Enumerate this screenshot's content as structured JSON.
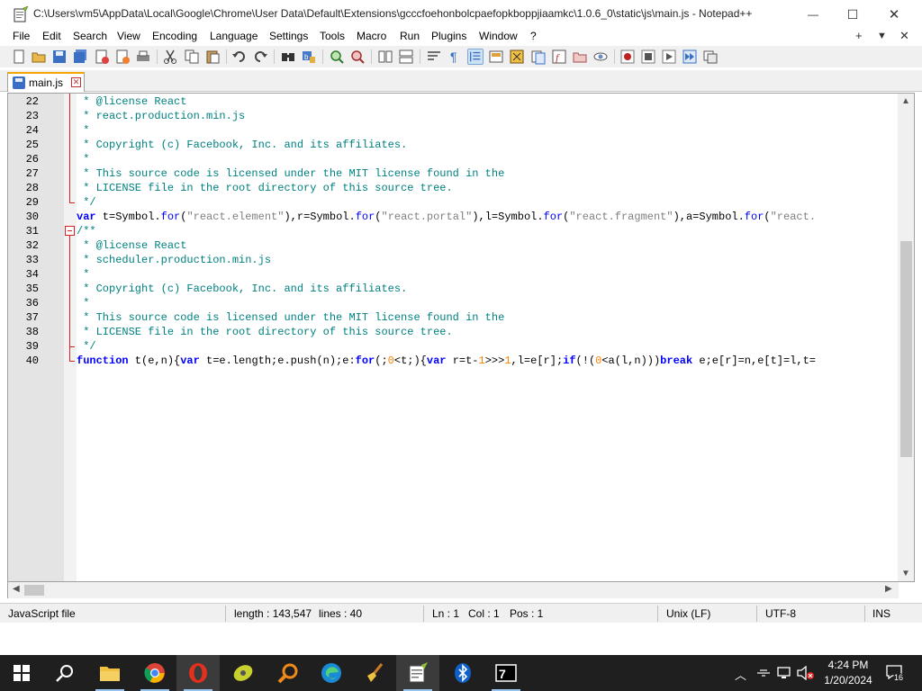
{
  "window": {
    "title": "C:\\Users\\vm5\\AppData\\Local\\Google\\Chrome\\User Data\\Default\\Extensions\\gcccfoehonbolcpaefopkboppjiaamkc\\1.0.6_0\\static\\js\\main.js - Notepad++",
    "min_glyph": "—",
    "max_glyph": "☐",
    "close_glyph": "✕"
  },
  "menu": {
    "items": [
      "File",
      "Edit",
      "Search",
      "View",
      "Encoding",
      "Language",
      "Settings",
      "Tools",
      "Macro",
      "Run",
      "Plugins",
      "Window",
      "?"
    ],
    "right_plus": "+",
    "right_down": "▼",
    "right_close": "✕"
  },
  "toolbar": {
    "icons": [
      "new-file-icon",
      "open-file-icon",
      "save-icon",
      "save-all-icon",
      "close-icon",
      "close-all-icon",
      "print-icon",
      "cut-icon",
      "copy-icon",
      "paste-icon",
      "undo-icon",
      "redo-icon",
      "find-icon",
      "replace-icon",
      "zoom-in-icon",
      "zoom-out-icon",
      "sync-vertical-icon",
      "sync-horizontal-icon",
      "word-wrap-icon",
      "show-all-chars-icon",
      "indent-guide-icon",
      "udl-icon",
      "doc-map-icon",
      "doc-list-icon",
      "function-list-icon",
      "folder-workspace-icon",
      "monitoring-icon",
      "record-macro-icon",
      "stop-macro-icon",
      "play-macro-icon",
      "run-macro-multiple-icon",
      "save-macro-icon"
    ]
  },
  "tab": {
    "label": "main.js",
    "close_glyph": "✕"
  },
  "editor": {
    "lines": [
      {
        "n": "22",
        "segments": [
          {
            "t": " * @license React",
            "c": "cmt"
          }
        ]
      },
      {
        "n": "23",
        "segments": [
          {
            "t": " * react.production.min.js",
            "c": "cmt"
          }
        ]
      },
      {
        "n": "24",
        "segments": [
          {
            "t": " *",
            "c": "cmt"
          }
        ]
      },
      {
        "n": "25",
        "segments": [
          {
            "t": " * Copyright (c) Facebook, Inc. and its affiliates.",
            "c": "cmt"
          }
        ]
      },
      {
        "n": "26",
        "segments": [
          {
            "t": " *",
            "c": "cmt"
          }
        ]
      },
      {
        "n": "27",
        "segments": [
          {
            "t": " * This source code is licensed under the MIT license found in the",
            "c": "cmt"
          }
        ]
      },
      {
        "n": "28",
        "segments": [
          {
            "t": " * LICENSE file in the root directory of this source tree.",
            "c": "cmt"
          }
        ]
      },
      {
        "n": "29",
        "segments": [
          {
            "t": " */",
            "c": "cmt"
          }
        ]
      },
      {
        "n": "30",
        "segments": [
          {
            "t": "var",
            "c": "kw"
          },
          {
            "t": " t=Symbol.",
            "c": "plain"
          },
          {
            "t": "for",
            "c": "fn"
          },
          {
            "t": "(",
            "c": "plain"
          },
          {
            "t": "\"react.element\"",
            "c": "str"
          },
          {
            "t": "),r=Symbol.",
            "c": "plain"
          },
          {
            "t": "for",
            "c": "fn"
          },
          {
            "t": "(",
            "c": "plain"
          },
          {
            "t": "\"react.portal\"",
            "c": "str"
          },
          {
            "t": "),l=Symbol.",
            "c": "plain"
          },
          {
            "t": "for",
            "c": "fn"
          },
          {
            "t": "(",
            "c": "plain"
          },
          {
            "t": "\"react.fragment\"",
            "c": "str"
          },
          {
            "t": "),a=Symbol.",
            "c": "plain"
          },
          {
            "t": "for",
            "c": "fn"
          },
          {
            "t": "(",
            "c": "plain"
          },
          {
            "t": "\"react.",
            "c": "str"
          }
        ]
      },
      {
        "n": "31",
        "segments": [
          {
            "t": "/**",
            "c": "cmt"
          }
        ]
      },
      {
        "n": "32",
        "segments": [
          {
            "t": " * @license React",
            "c": "cmt"
          }
        ]
      },
      {
        "n": "33",
        "segments": [
          {
            "t": " * scheduler.production.min.js",
            "c": "cmt"
          }
        ]
      },
      {
        "n": "34",
        "segments": [
          {
            "t": " *",
            "c": "cmt"
          }
        ]
      },
      {
        "n": "35",
        "segments": [
          {
            "t": " * Copyright (c) Facebook, Inc. and its affiliates.",
            "c": "cmt"
          }
        ]
      },
      {
        "n": "36",
        "segments": [
          {
            "t": " *",
            "c": "cmt"
          }
        ]
      },
      {
        "n": "37",
        "segments": [
          {
            "t": " * This source code is licensed under the MIT license found in the",
            "c": "cmt"
          }
        ]
      },
      {
        "n": "38",
        "segments": [
          {
            "t": " * LICENSE file in the root directory of this source tree.",
            "c": "cmt"
          }
        ]
      },
      {
        "n": "39",
        "segments": [
          {
            "t": " */",
            "c": "cmt"
          }
        ]
      },
      {
        "n": "40",
        "segments": [
          {
            "t": "function",
            "c": "kw"
          },
          {
            "t": " t(e,n){",
            "c": "plain"
          },
          {
            "t": "var",
            "c": "kw"
          },
          {
            "t": " t=e.length;e.push(n);e:",
            "c": "plain"
          },
          {
            "t": "for",
            "c": "kw"
          },
          {
            "t": "(;",
            "c": "plain"
          },
          {
            "t": "0",
            "c": "num"
          },
          {
            "t": "<t;){",
            "c": "plain"
          },
          {
            "t": "var",
            "c": "kw"
          },
          {
            "t": " r=t-",
            "c": "plain"
          },
          {
            "t": "1",
            "c": "num"
          },
          {
            "t": ">>>",
            "c": "plain"
          },
          {
            "t": "1",
            "c": "num"
          },
          {
            "t": ",l=e[r];",
            "c": "plain"
          },
          {
            "t": "if",
            "c": "kw"
          },
          {
            "t": "(!(",
            "c": "plain"
          },
          {
            "t": "0",
            "c": "num"
          },
          {
            "t": "<a(l,n)))",
            "c": "plain"
          },
          {
            "t": "break",
            "c": "kw"
          },
          {
            "t": " e;e[r]=n,e[t]=l,t=",
            "c": "plain"
          }
        ]
      }
    ]
  },
  "statusbar": {
    "file_type": "JavaScript file",
    "length": "length : 143,547",
    "lines": "lines : 40",
    "ln": "Ln : 1",
    "col": "Col : 1",
    "pos": "Pos : 1",
    "eol": "Unix (LF)",
    "encoding": "UTF-8",
    "mode": "INS"
  },
  "taskbar": {
    "apps": [
      "start-icon",
      "search-icon",
      "file-explorer-icon",
      "chrome-icon",
      "opera-icon",
      "app-yellow-icon",
      "search-everything-icon",
      "edge-icon",
      "broom-icon",
      "notepadpp-icon",
      "bluetooth-icon",
      "sevenzip-icon"
    ],
    "time": "4:24 PM",
    "date": "1/20/2024",
    "notif_count": "16"
  }
}
